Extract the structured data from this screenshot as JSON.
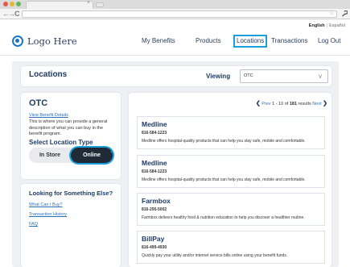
{
  "browser": {
    "back": "←",
    "forward": "→",
    "reload": "C",
    "tab_close": "×",
    "star": "☆",
    "menu_icon": "wrench-icon"
  },
  "language": {
    "english": "English",
    "separator": "|",
    "spanish": "Español"
  },
  "header": {
    "logo_text": "Logo Here",
    "nav": [
      {
        "label": "My Benefits",
        "active": false
      },
      {
        "label": "Products",
        "active": false
      },
      {
        "label": "Locations",
        "active": true
      },
      {
        "label": "Transactions",
        "active": false
      },
      {
        "label": "Log Out",
        "active": false
      }
    ]
  },
  "locations": {
    "title": "Locations",
    "viewing_label": "Viewing",
    "viewing_value": "OTC",
    "chevron": "∨"
  },
  "benefit": {
    "title": "OTC",
    "details_link": "View Benefit Details",
    "description": "This is where you can provide a general description of what you can buy in the benefit program.",
    "select_title": "Select Location Type",
    "options": [
      {
        "label": "In Store",
        "selected": false
      },
      {
        "label": "Online",
        "selected": true
      }
    ]
  },
  "else_panel": {
    "title": "Looking for Something Else?",
    "links": [
      "What Can I Buy?",
      "Transaction History",
      "FAQ"
    ]
  },
  "pager": {
    "prev_chevron": "❮",
    "prev": "Prev",
    "range": "1 - 10 of",
    "total": "181",
    "results": "results",
    "next": "Next",
    "next_chevron": "❯"
  },
  "results": [
    {
      "name": "Medline",
      "phone": "816-584-1223",
      "description": "Medline offers hospital-quality products that can help you stay safe, mobile and comfortable."
    },
    {
      "name": "Medline",
      "phone": "816-584-1223",
      "description": "Medline offers hospital-quality products that can help you stay safe, mobile and comfortable."
    },
    {
      "name": "Farmbox",
      "phone": "816-295-5002",
      "description": "Farmbox delivers healthy food & nutrition education to help you discover a healthier routine."
    },
    {
      "name": "BillPay",
      "phone": "816-499-4930",
      "description": "Quickly pay your utility and/or internet service bills online using your benefit funds."
    }
  ],
  "colors": {
    "accent": "#1ba0dd",
    "link": "#2b72b8",
    "heading": "#1f3b66",
    "toggle_active": "#1f2a36"
  }
}
